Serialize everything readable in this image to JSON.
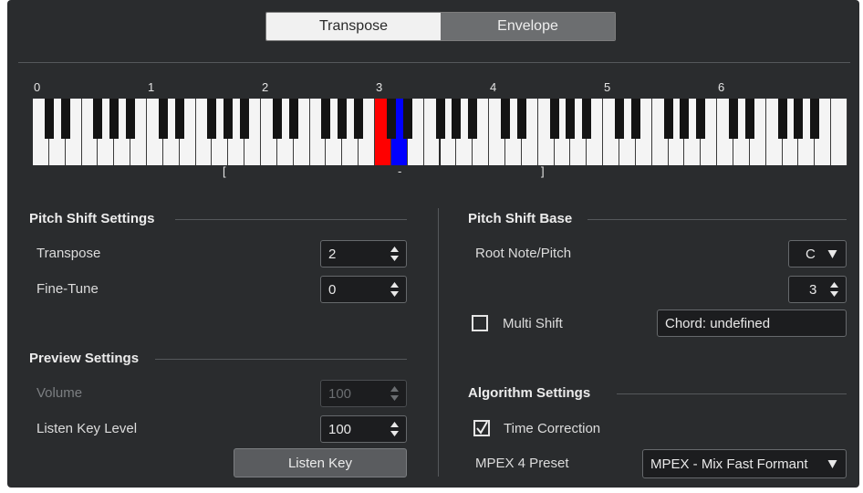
{
  "tabs": [
    {
      "label": "Transpose",
      "active": true
    },
    {
      "label": "Envelope",
      "active": false
    }
  ],
  "keyboard": {
    "octave_labels": [
      "0",
      "1",
      "2",
      "3",
      "4",
      "5",
      "6"
    ],
    "range_start_mark": "[",
    "root_mark": "-",
    "range_end_mark": "]",
    "root_key_color": "#ff0000",
    "target_key_color": "#0000ff"
  },
  "pitch_shift_settings": {
    "title": "Pitch Shift Settings",
    "transpose_label": "Transpose",
    "transpose_value": "2",
    "fine_tune_label": "Fine-Tune",
    "fine_tune_value": "0"
  },
  "preview_settings": {
    "title": "Preview Settings",
    "volume_label": "Volume",
    "volume_value": "100",
    "listen_key_level_label": "Listen Key Level",
    "listen_key_level_value": "100",
    "listen_key_button": "Listen Key"
  },
  "pitch_shift_base": {
    "title": "Pitch Shift Base",
    "root_label": "Root Note/Pitch",
    "root_note": "C",
    "octave": "3",
    "multi_shift_label": "Multi Shift",
    "multi_shift_checked": false,
    "chord_value": "Chord: undefined"
  },
  "algorithm_settings": {
    "title": "Algorithm Settings",
    "time_correction_label": "Time Correction",
    "time_correction_checked": true,
    "preset_label": "MPEX 4 Preset",
    "preset_value": "MPEX - Mix Fast Formant"
  }
}
